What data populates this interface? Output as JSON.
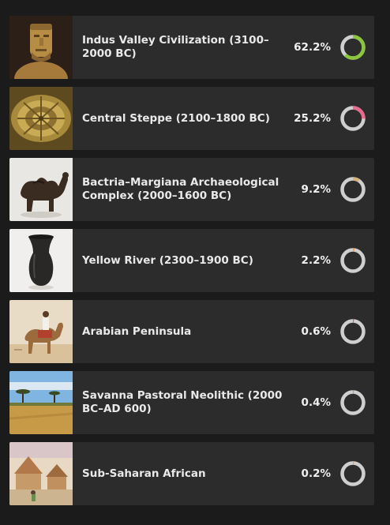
{
  "populations": [
    {
      "name": "Indus Valley Civilization (3100–2000 BC)",
      "percent_text": "62.2%",
      "fraction": 0.622,
      "color": "#8cc63e",
      "image": "stone-bust-icon"
    },
    {
      "name": "Central Steppe (2100–1800 BC)",
      "percent_text": "25.2%",
      "fraction": 0.252,
      "color": "#e96a8f",
      "image": "gold-disc-icon"
    },
    {
      "name": "Bactria–Margiana Archaeological Complex (2000–1600 BC)",
      "percent_text": "9.2%",
      "fraction": 0.092,
      "color": "#d9b27a",
      "image": "camel-figurine-icon"
    },
    {
      "name": "Yellow River (2300–1900 BC)",
      "percent_text": "2.2%",
      "fraction": 0.022,
      "color": "#f0a04a",
      "image": "black-vase-icon"
    },
    {
      "name": "Arabian Peninsula",
      "percent_text": "0.6%",
      "fraction": 0.006,
      "color": "#c15aa0",
      "image": "camel-rider-icon"
    },
    {
      "name": "Savanna Pastoral Neolithic (2000 BC–AD 600)",
      "percent_text": "0.4%",
      "fraction": 0.004,
      "color": "#7fc24a",
      "image": "savanna-landscape-icon"
    },
    {
      "name": "Sub-Saharan African",
      "percent_text": "0.2%",
      "fraction": 0.002,
      "color": "#f0a04a",
      "image": "village-scene-icon"
    }
  ],
  "ring_track_color": "#cfcfcf"
}
